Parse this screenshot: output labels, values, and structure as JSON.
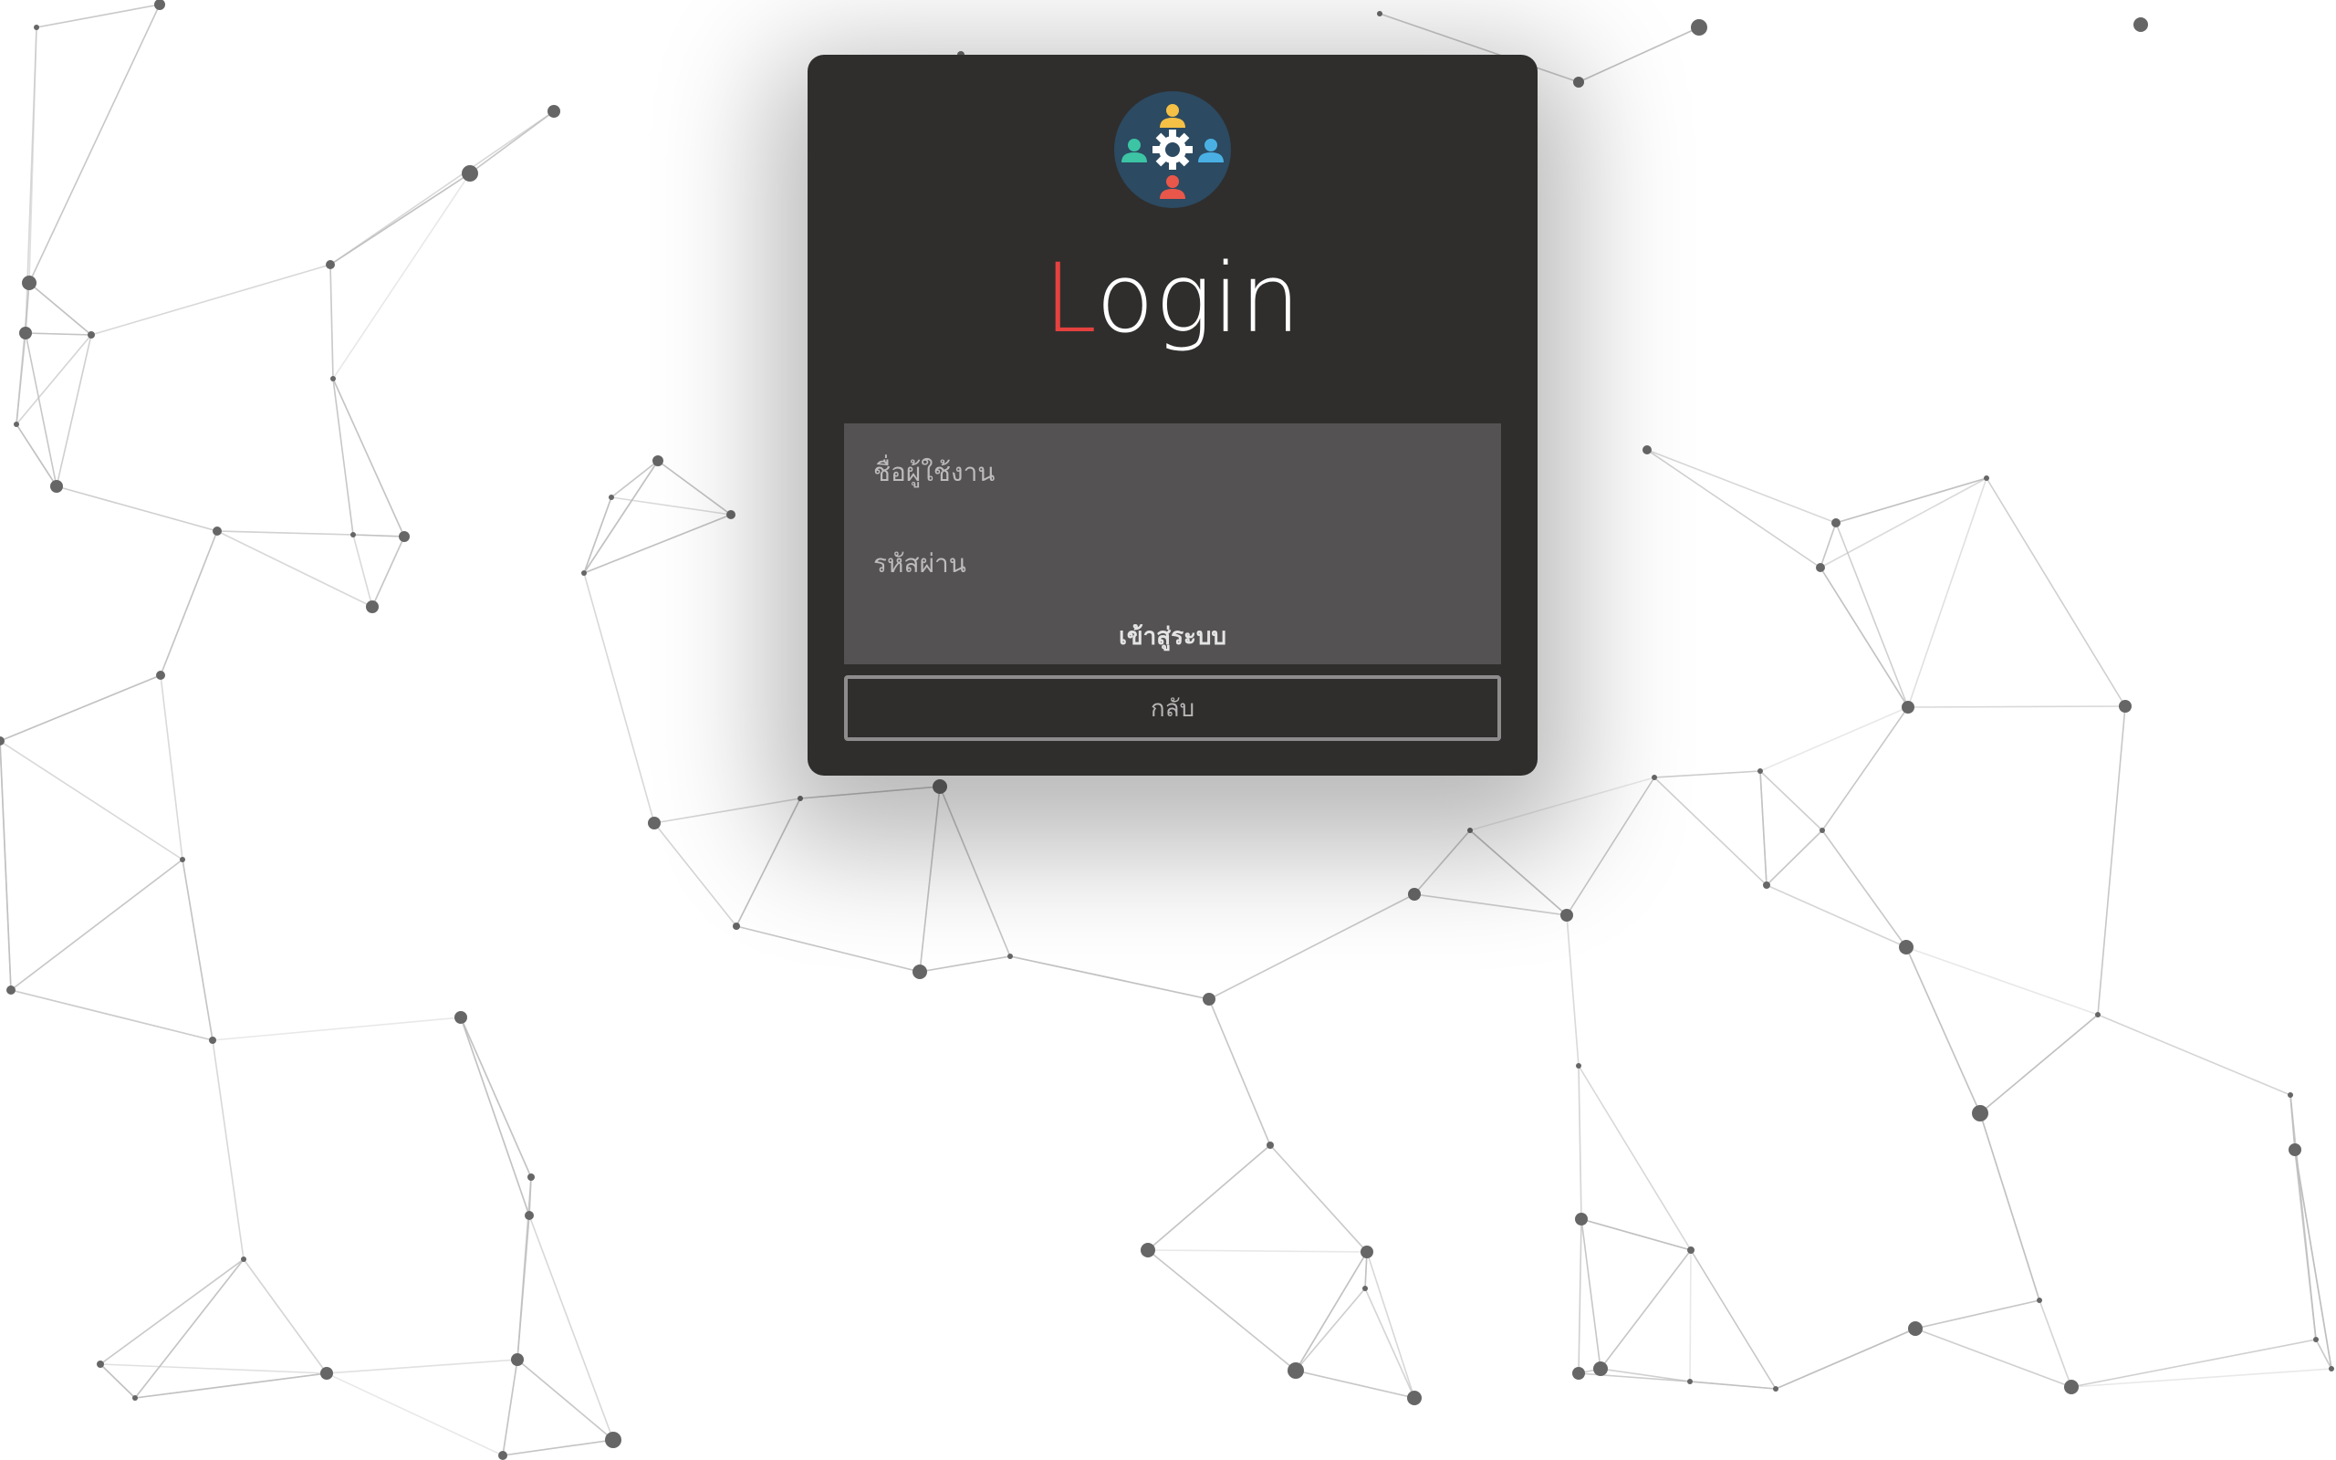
{
  "login": {
    "title_first": "L",
    "title_rest": "ogin",
    "logo_icon": "team-gear-icon",
    "username_placeholder": "ชื่อผู้ใช้งาน",
    "password_placeholder": "รหัสผ่าน",
    "submit_label": "เข้าสู่ระบบ",
    "back_label": "กลับ"
  },
  "colors": {
    "card": "#2f2e2d",
    "panel": "#545253",
    "accent": "#e5413f",
    "logo_bg": "#2c4a61"
  }
}
